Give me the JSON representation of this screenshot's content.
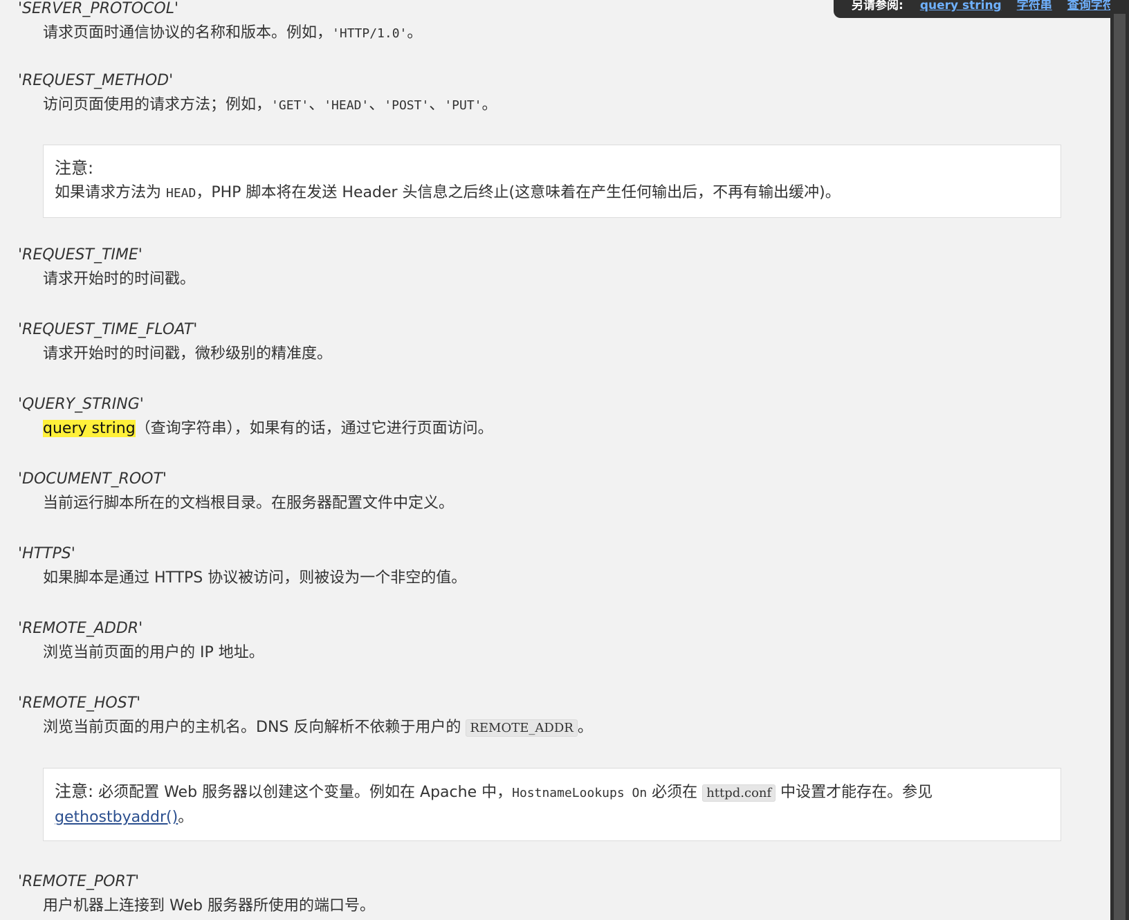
{
  "float_bar": {
    "label": "另请参阅:",
    "links": [
      "query string",
      "字符串",
      "查询字符串"
    ]
  },
  "entries": [
    {
      "term": "'SERVER_PROTOCOL'",
      "def_pre": "请求页面时通信协议的名称和版本。例如，",
      "def_code": "'HTTP/1.0'",
      "def_post": "。"
    },
    {
      "term": "'REQUEST_METHOD'",
      "def_pre": "访问页面使用的请求方法；例如，",
      "codes": [
        "'GET'",
        "'HEAD'",
        "'POST'",
        "'PUT'"
      ],
      "sep": "、",
      "def_post": "。"
    },
    {
      "term": "'REQUEST_TIME'",
      "def": "请求开始时的时间戳。"
    },
    {
      "term": "'REQUEST_TIME_FLOAT'",
      "def": "请求开始时的时间戳，微秒级别的精准度。"
    },
    {
      "term": "'QUERY_STRING'",
      "def_highlight": "query string",
      "def_post": "（查询字符串），如果有的话，通过它进行页面访问。"
    },
    {
      "term": "'DOCUMENT_ROOT'",
      "def": "当前运行脚本所在的文档根目录。在服务器配置文件中定义。"
    },
    {
      "term": "'HTTPS'",
      "def": "如果脚本是通过 HTTPS 协议被访问，则被设为一个非空的值。"
    },
    {
      "term": "'REMOTE_ADDR'",
      "def": "浏览当前页面的用户的 IP 地址。"
    },
    {
      "term": "'REMOTE_HOST'",
      "def_pre": "浏览当前页面的用户的主机名。DNS 反向解析不依赖于用户的",
      "def_code": "REMOTE_ADDR",
      "def_post": "。"
    },
    {
      "term": "'REMOTE_PORT'",
      "def": "用户机器上连接到 Web 服务器所使用的端口号。"
    }
  ],
  "notes": {
    "head_note": {
      "title": "注意:",
      "pre": "如果请求方法为 ",
      "code": "HEAD",
      "post": "，PHP 脚本将在发送 Header 头信息之后终止(这意味着在产生任何输出后，不再有输出缓冲)。"
    },
    "remote_host_note": {
      "title": "注意:",
      "pre": " 必须配置 Web 服务器以创建这个变量。例如在 Apache 中，",
      "code1": "HostnameLookups On",
      "mid": " 必须在 ",
      "code2": "httpd.conf",
      "post": " 中设置才能存在。参见",
      "link": "gethostbyaddr()",
      "end": "。"
    }
  }
}
